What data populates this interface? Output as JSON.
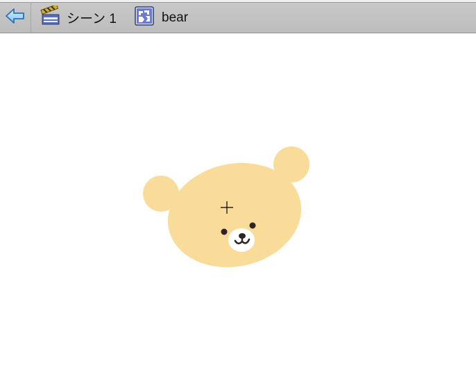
{
  "toolbar": {
    "back_icon": "back-arrow-icon",
    "breadcrumbs": [
      {
        "label": "シーン 1",
        "icon": "scene-clapperboard-icon"
      },
      {
        "label": "bear",
        "icon": "movie-clip-symbol-icon"
      }
    ]
  },
  "stage": {
    "symbol": "bear",
    "colors": {
      "fur": "#fadc9a",
      "muzzle": "#ffffff",
      "features": "#2e2424",
      "registration_point": "#000000"
    }
  }
}
